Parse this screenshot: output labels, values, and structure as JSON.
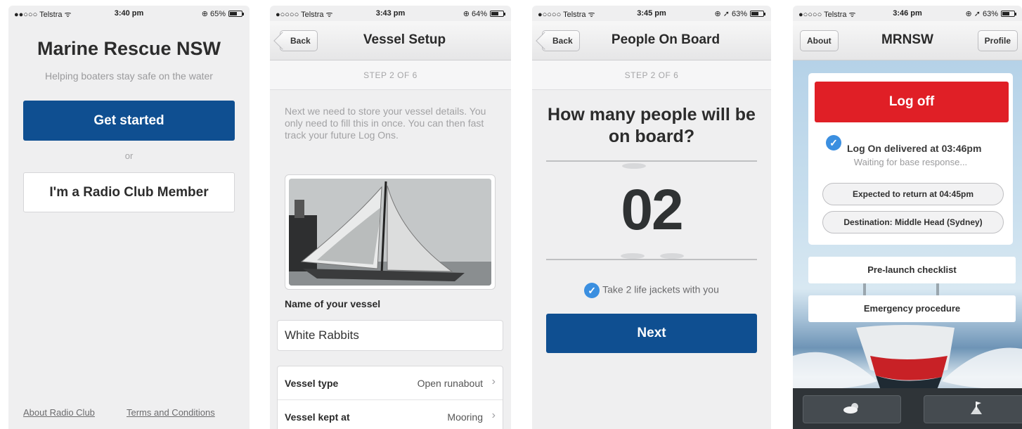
{
  "screens": [
    {
      "status": {
        "carrier": "●●○○○ Telstra ᯤ",
        "time": "3:40 pm",
        "battery": "⊕ 65%",
        "battery_level": 0.65
      },
      "title": "Marine Rescue NSW",
      "subtitle": "Helping boaters stay safe on the water",
      "get_started": "Get started",
      "or": "or",
      "radio_member": "I'm a Radio Club Member",
      "footer_left": "About Radio Club",
      "footer_right": "Terms and Conditions"
    },
    {
      "status": {
        "carrier": "●○○○○ Telstra ᯤ",
        "time": "3:43 pm",
        "battery": "⊕ 64%",
        "battery_level": 0.64
      },
      "back": "Back",
      "title": "Vessel Setup",
      "step": "STEP 2 OF 6",
      "intro": "Next we need to store your vessel details. You only need to fill this in once. You can then fast track your future Log Ons.",
      "name_label": "Name of your vessel",
      "name_value": "White Rabbits",
      "rows": [
        {
          "label": "Vessel type",
          "value": "Open runabout"
        },
        {
          "label": "Vessel kept at",
          "value": "Mooring"
        }
      ]
    },
    {
      "status": {
        "carrier": "●○○○○ Telstra ᯤ",
        "time": "3:45 pm",
        "battery": "⊕ ➚ 63%",
        "battery_level": 0.63
      },
      "back": "Back",
      "title": "People On Board",
      "step": "STEP 2 OF 6",
      "question": "How many people will be on board?",
      "count": "02",
      "jackets": "Take 2 life jackets with you",
      "next": "Next"
    },
    {
      "status": {
        "carrier": "●○○○○ Telstra ᯤ",
        "time": "3:46 pm",
        "battery": "⊕ ➚ 63%",
        "battery_level": 0.63
      },
      "about": "About",
      "title": "MRNSW",
      "profile": "Profile",
      "log_off": "Log off",
      "delivered": "Log On delivered at 03:46pm",
      "waiting": "Waiting for base response...",
      "expected": "Expected to return at 04:45pm",
      "destination": "Destination: Middle Head (Sydney)",
      "checklist": "Pre-launch checklist",
      "emergency": "Emergency procedure",
      "tabs": [
        {
          "icon": "weather-icon"
        },
        {
          "icon": "flag-icon"
        }
      ]
    }
  ],
  "colors": {
    "primary": "#0f4f91",
    "danger": "#e01f26",
    "check": "#3b8fe0",
    "background": "#efeff0"
  }
}
